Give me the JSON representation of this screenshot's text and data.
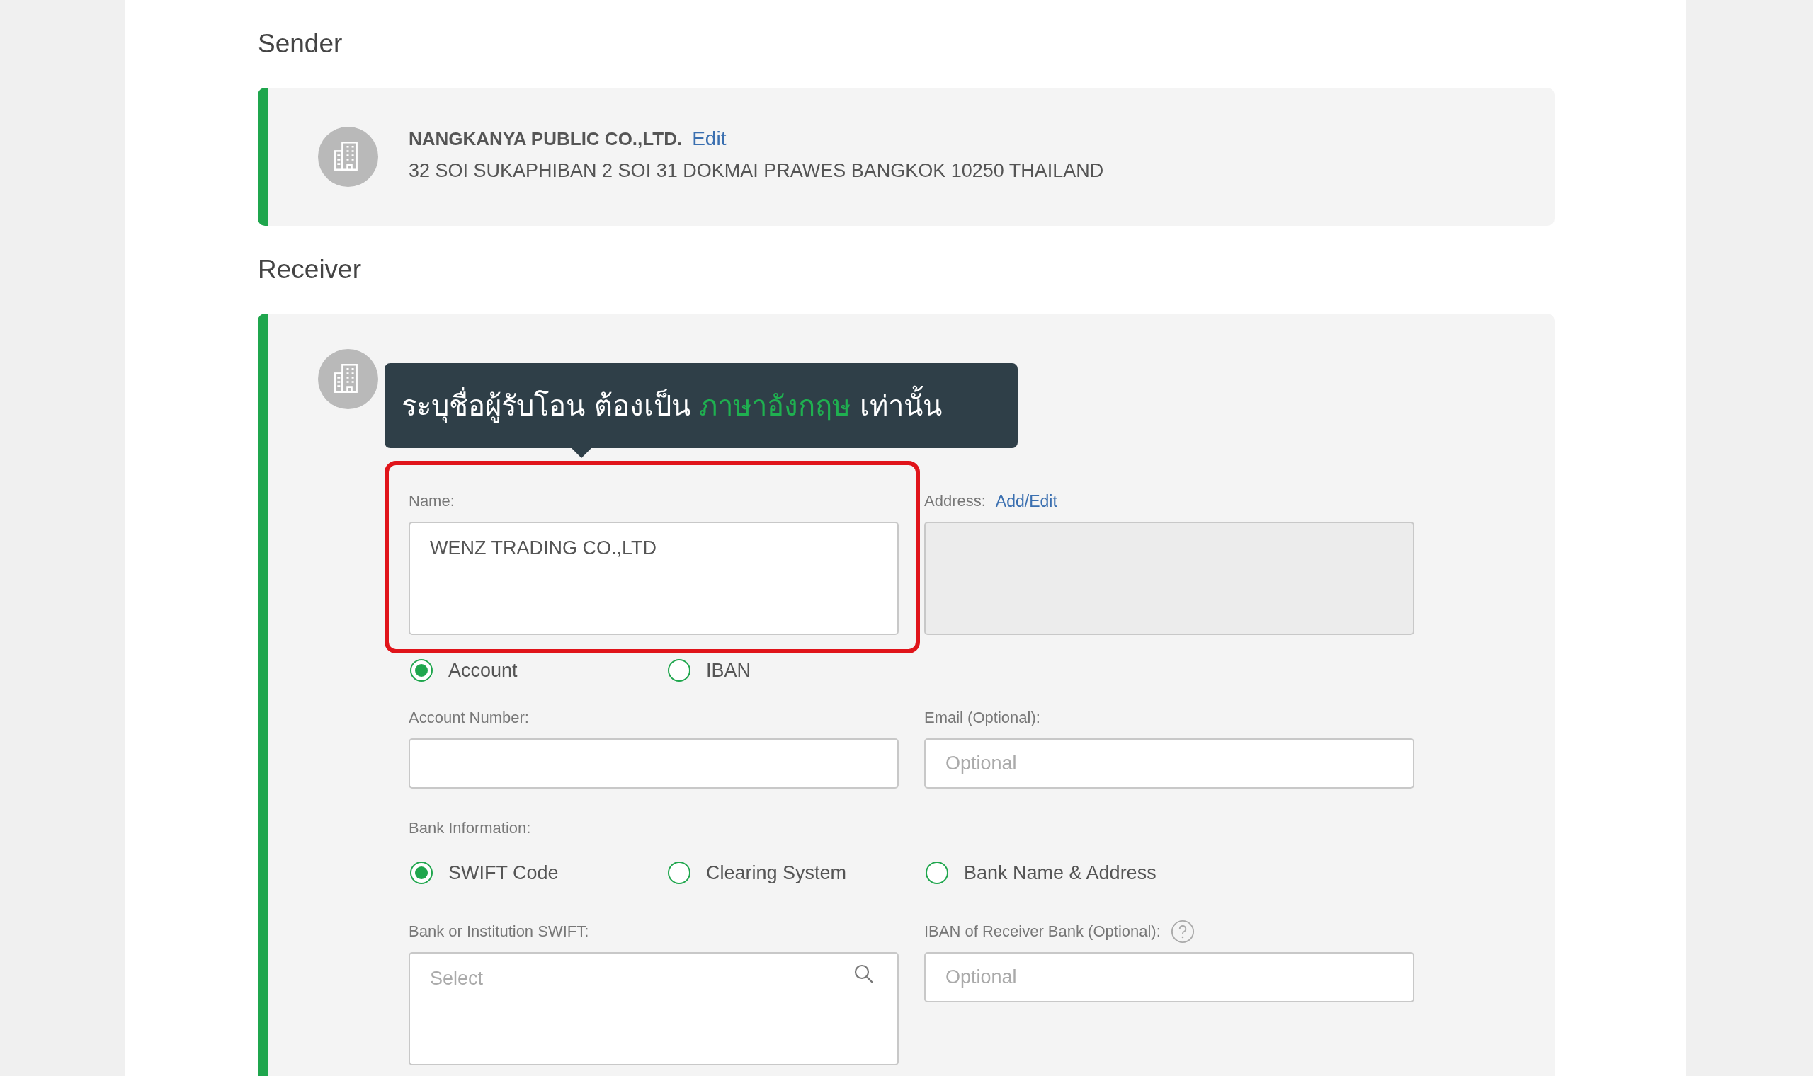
{
  "sender": {
    "heading": "Sender",
    "name": "NANGKANYA PUBLIC CO.,LTD.",
    "edit_link": "Edit",
    "address": "32 SOI SUKAPHIBAN 2 SOI 31 DOKMAI PRAWES BANGKOK 10250 THAILAND"
  },
  "receiver": {
    "heading": "Receiver",
    "tooltip": [
      {
        "text": "ระบุชื่อผู้รับโอน ต้องเป็น ",
        "highlight": false
      },
      {
        "text": "ภาษาอังกฤษ",
        "highlight": true
      },
      {
        "text": " เท่านั้น",
        "highlight": false
      }
    ],
    "name_label": "Name:",
    "name_value": "WENZ TRADING CO.,LTD",
    "address_label": "Address:",
    "address_link": "Add/Edit",
    "account_types": [
      {
        "label": "Account",
        "selected": true
      },
      {
        "label": "IBAN",
        "selected": false
      }
    ],
    "account_number_label": "Account Number:",
    "email_label": "Email (Optional):",
    "email_placeholder": "Optional",
    "bank_info_label": "Bank Information:",
    "bank_options": [
      {
        "label": "SWIFT Code",
        "selected": true
      },
      {
        "label": "Clearing System",
        "selected": false
      },
      {
        "label": "Bank Name & Address",
        "selected": false
      }
    ],
    "swift_label": "Bank or Institution SWIFT:",
    "swift_placeholder": "Select",
    "iban_label": "IBAN of Receiver Bank (Optional):",
    "iban_placeholder": "Optional"
  }
}
